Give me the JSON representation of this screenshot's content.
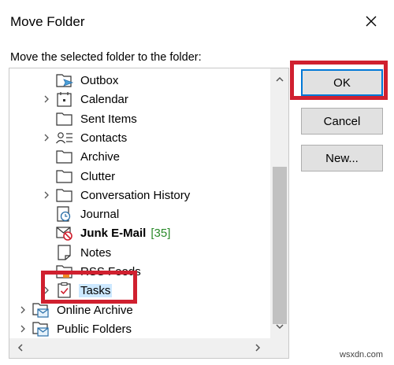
{
  "dialog": {
    "title": "Move Folder",
    "prompt": "Move the selected folder to the folder:",
    "close_icon": "close-x-icon"
  },
  "tree": {
    "items": [
      {
        "label": "Outbox",
        "icon": "outbox-icon",
        "expandable": false
      },
      {
        "label": "Calendar",
        "icon": "calendar-icon",
        "expandable": true
      },
      {
        "label": "Sent Items",
        "icon": "folder-icon",
        "expandable": false
      },
      {
        "label": "Contacts",
        "icon": "contacts-icon",
        "expandable": true
      },
      {
        "label": "Archive",
        "icon": "folder-icon",
        "expandable": false
      },
      {
        "label": "Clutter",
        "icon": "folder-icon",
        "expandable": false
      },
      {
        "label": "Conversation History",
        "icon": "folder-icon",
        "expandable": true
      },
      {
        "label": "Journal",
        "icon": "journal-icon",
        "expandable": false
      },
      {
        "label": "Junk E-Mail",
        "icon": "junk-mail-icon",
        "expandable": false,
        "bold": true,
        "count": "[35]"
      },
      {
        "label": "Notes",
        "icon": "notes-icon",
        "expandable": false
      },
      {
        "label": "RSS Feeds",
        "icon": "rss-folder-icon",
        "expandable": false
      },
      {
        "label": "Tasks",
        "icon": "tasks-icon",
        "expandable": true,
        "selected": true
      },
      {
        "label": "Online Archive",
        "icon": "mailbox-icon",
        "expandable": true
      },
      {
        "label": "Public Folders",
        "icon": "mailbox-icon",
        "expandable": true
      }
    ]
  },
  "buttons": {
    "ok": "OK",
    "cancel": "Cancel",
    "new": "New..."
  },
  "colors": {
    "highlight": "#d0202f",
    "selection": "#cce8ff",
    "default_button_border": "#0078d7",
    "count": "#2a8a2a"
  },
  "watermark": "wsxdn.com"
}
